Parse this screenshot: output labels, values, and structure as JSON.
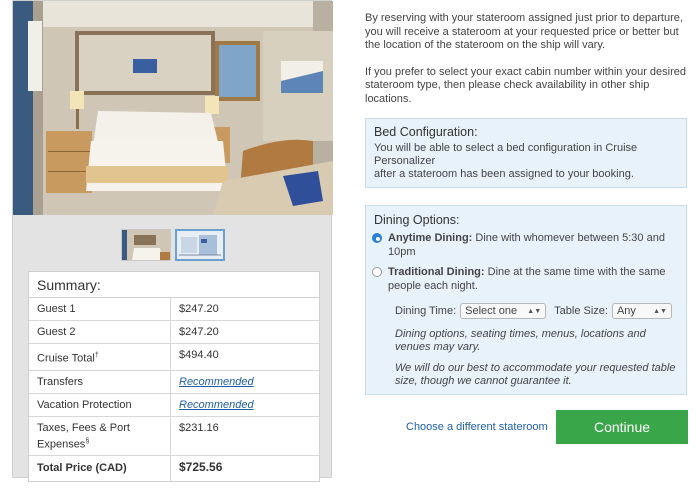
{
  "summary": {
    "title": "Summary:",
    "rows": [
      {
        "label": "Guest 1",
        "value": "$247.20"
      },
      {
        "label": "Guest 2",
        "value": "$247.20"
      },
      {
        "label": "Cruise Total",
        "sup": "†",
        "value": "$494.40"
      },
      {
        "label": "Transfers",
        "value": "Recommended"
      },
      {
        "label": "Vacation Protection",
        "value": "Recommended"
      },
      {
        "label": "Taxes, Fees & Port Expenses",
        "sup": "§",
        "value": "$231.16"
      },
      {
        "label": "Total Price (CAD)",
        "value": "$725.56"
      }
    ]
  },
  "intro": {
    "p1": "By reserving with your stateroom assigned just prior to departure, you will receive a stateroom at your requested price or better but the location of the stateroom on the ship will vary.",
    "p2": "If you prefer to select your exact cabin number within your desired stateroom type, then please check availability in other ship locations."
  },
  "bed": {
    "title": "Bed Configuration:",
    "line1": "You will be able to select a bed configuration in Cruise Personalizer",
    "line2": "after a stateroom has been assigned to your booking."
  },
  "dining": {
    "title": "Dining Options:",
    "anytime_label": "Anytime Dining:",
    "anytime_text": " Dine with whomever between 5:30 and 10pm",
    "traditional_label": "Traditional Dining:",
    "traditional_text": " Dine at the same time with the same people each night.",
    "time_label": "Dining Time:",
    "time_value": "Select one",
    "size_label": "Table Size:",
    "size_value": "Any",
    "note1": "Dining options, seating times, menus, locations and venues may vary.",
    "note2": "We will do our best to accommodate your requested table size, though we cannot guarantee it."
  },
  "actions": {
    "change_link": "Choose a different stateroom",
    "continue": "Continue"
  },
  "colors": {
    "accent_green": "#3aa64a",
    "link_blue": "#1f5fa8",
    "info_box_bg": "#e8f2fb"
  }
}
